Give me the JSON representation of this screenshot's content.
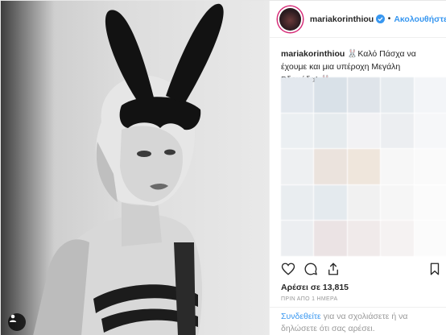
{
  "post": {
    "username": "mariakorinthiou",
    "follow_label": "Ακολουθήστε",
    "separator": "•",
    "caption_user": "mariakorinthiou",
    "caption_text": "Καλό Πάσχα να έχουμε και μια υπέροχη Μεγάλη Βδομάδα!",
    "caption_emoji": "🐰",
    "likes": "Αρέσει σε 13,815",
    "time": "ΠΡΙΝ ΑΠΟ 1 ΗΜΕΡΑ",
    "login_link": "Συνδεθείτε",
    "login_text": " για να σχολιάσετε ή να δηλώσετε ότι σας αρέσει."
  },
  "colors": {
    "accent": "#3897f0",
    "text": "#262626",
    "muted": "#999999",
    "border": "#efefef"
  },
  "comment_blur_colors": [
    "#e3e8ee",
    "#d9e1e8",
    "#dfe4ea",
    "#e6ebef",
    "#f3f5f8",
    "#ebeff2",
    "#e6ebee",
    "#f2f2f4",
    "#eceef1",
    "#f6f7f9",
    "#eef0f2",
    "#ebe3dd",
    "#efe6dc",
    "#f7f7f7",
    "#fafafa",
    "#e9edf0",
    "#e4eaee",
    "#f1f1f1",
    "#f6f6f6",
    "#fbfbfb",
    "#eceef1",
    "#ebe3e4",
    "#f0eaea",
    "#f5f2f2",
    "#fbfbfb"
  ],
  "icons": {
    "like": "heart-icon",
    "comment": "comment-icon",
    "share": "share-icon",
    "save": "bookmark-icon",
    "verified": "verified-badge-icon",
    "photo_user": "user-tag-icon"
  }
}
